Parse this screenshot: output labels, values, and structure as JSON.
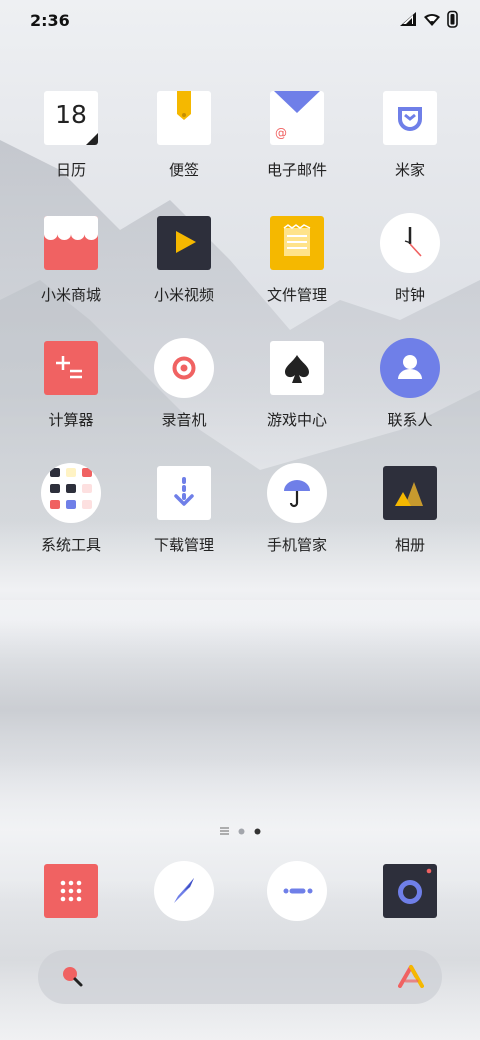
{
  "status_bar": {
    "time": "2:36",
    "icons": [
      "signal-icon",
      "wifi-icon",
      "battery-icon"
    ]
  },
  "apps": [
    {
      "label": "日历",
      "icon": "calendar-icon",
      "day": "18"
    },
    {
      "label": "便签",
      "icon": "notes-icon"
    },
    {
      "label": "电子邮件",
      "icon": "email-icon"
    },
    {
      "label": "米家",
      "icon": "mijia-icon"
    },
    {
      "label": "小米商城",
      "icon": "mi-store-icon"
    },
    {
      "label": "小米视频",
      "icon": "mi-video-icon"
    },
    {
      "label": "文件管理",
      "icon": "file-manager-icon"
    },
    {
      "label": "时钟",
      "icon": "clock-icon"
    },
    {
      "label": "计算器",
      "icon": "calculator-icon"
    },
    {
      "label": "录音机",
      "icon": "recorder-icon"
    },
    {
      "label": "游戏中心",
      "icon": "game-center-icon"
    },
    {
      "label": "联系人",
      "icon": "contacts-icon"
    },
    {
      "label": "系统工具",
      "icon": "system-tools-folder-icon"
    },
    {
      "label": "下载管理",
      "icon": "downloads-icon"
    },
    {
      "label": "手机管家",
      "icon": "security-icon"
    },
    {
      "label": "相册",
      "icon": "gallery-icon"
    }
  ],
  "page_indicator": {
    "pages": 3,
    "current": 3
  },
  "dock": [
    {
      "icon": "phone-dialer-icon"
    },
    {
      "icon": "browser-compass-icon"
    },
    {
      "icon": "messages-icon"
    },
    {
      "icon": "camera-icon"
    }
  ],
  "search_bar": {
    "left_icon": "search-icon",
    "right_icon": "assistant-icon"
  },
  "colors": {
    "red": "#f06262",
    "dark": "#2d2f3b",
    "yellow": "#f5b800",
    "blue": "#6f7fe8"
  }
}
